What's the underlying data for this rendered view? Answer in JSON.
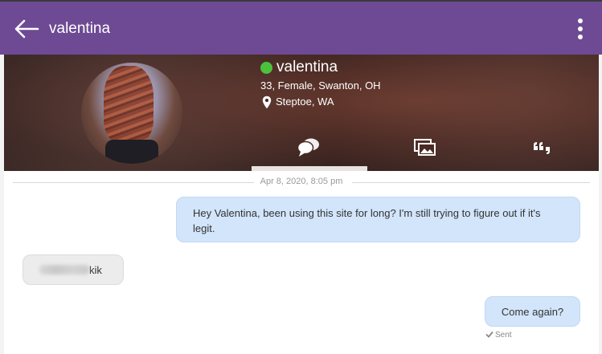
{
  "header": {
    "title": "valentina",
    "back_icon": "arrow-left-icon",
    "menu_icon": "more-vertical-icon",
    "bg_color": "#6d4a93"
  },
  "profile": {
    "name": "valentina",
    "online": true,
    "online_color": "#4cc13e",
    "details": "33, Female, Swanton, OH",
    "location": "Steptoe, WA",
    "tabs": [
      {
        "icon": "chat-bubbles-icon",
        "active": true
      },
      {
        "icon": "photos-icon",
        "active": false
      },
      {
        "icon": "quote-icon",
        "active": false
      }
    ]
  },
  "conversation": {
    "date_separator": "Apr 8, 2020, 8:05 pm",
    "messages": [
      {
        "direction": "out",
        "text": "Hey Valentina, been using this site for long? I'm still trying to figure out if it's legit."
      },
      {
        "direction": "in",
        "text": "kik",
        "redacted_prefix": true
      },
      {
        "direction": "out",
        "text": "Come again?",
        "status": "Sent"
      }
    ]
  }
}
